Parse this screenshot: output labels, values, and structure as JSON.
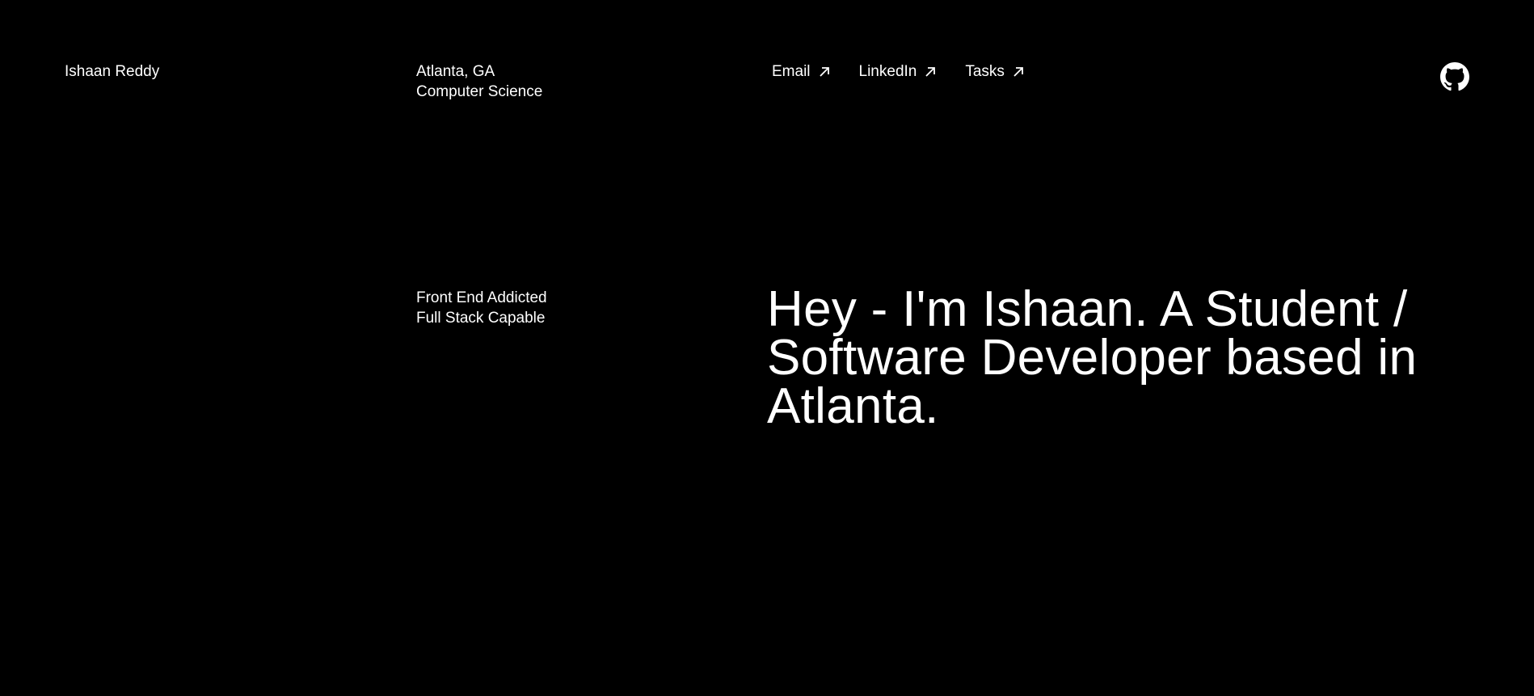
{
  "header": {
    "name": "Ishaan Reddy",
    "location": "Atlanta, GA",
    "field": "Computer Science"
  },
  "nav": {
    "links": [
      {
        "label": "Email",
        "icon": "arrow-up-right-icon"
      },
      {
        "label": "LinkedIn",
        "icon": "arrow-up-right-icon"
      },
      {
        "label": "Tasks",
        "icon": "arrow-up-right-icon"
      }
    ],
    "github_icon": "github-icon"
  },
  "tagline": {
    "line1": "Front End Addicted",
    "line2": "Full Stack Capable"
  },
  "hero": {
    "line1": "Hey - I'm Ishaan. A Student /",
    "line2": "Software Developer based in",
    "line3": "Atlanta."
  },
  "colors": {
    "background": "#000000",
    "text": "#ffffff"
  }
}
